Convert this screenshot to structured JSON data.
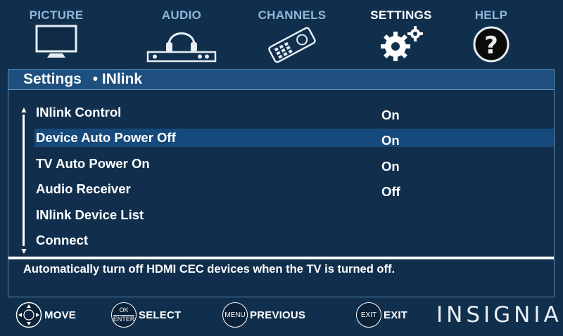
{
  "nav": {
    "tabs": [
      {
        "label": "PICTURE",
        "icon": "tv-icon",
        "active": false
      },
      {
        "label": "AUDIO",
        "icon": "headphones-soundbar-icon",
        "active": false
      },
      {
        "label": "CHANNELS",
        "icon": "remote-control-icon",
        "active": false
      },
      {
        "label": "SETTINGS",
        "icon": "gears-icon",
        "active": true
      },
      {
        "label": "HELP",
        "icon": "question-mark-icon",
        "active": false
      }
    ]
  },
  "header": {
    "section": "Settings",
    "subsection": "INlink",
    "separator": "•"
  },
  "menu": {
    "items": [
      {
        "label": "INlink Control",
        "value": "On",
        "selected": false
      },
      {
        "label": "Device Auto Power Off",
        "value": "On",
        "selected": true
      },
      {
        "label": "TV Auto Power On",
        "value": "On",
        "selected": false
      },
      {
        "label": "Audio Receiver",
        "value": "Off",
        "selected": false
      },
      {
        "label": "INlink Device List",
        "value": "",
        "selected": false
      },
      {
        "label": "Connect",
        "value": "",
        "selected": false
      }
    ]
  },
  "description": "Automatically turn off HDMI CEC devices when the TV is turned off.",
  "footer": {
    "hints": [
      {
        "label": "MOVE",
        "button": "dpad-icon",
        "button_text": ""
      },
      {
        "label": "SELECT",
        "button": "ok-enter-button-icon",
        "button_text": "OK",
        "button_text2": "ENTER"
      },
      {
        "label": "PREVIOUS",
        "button": "menu-button-icon",
        "button_text": "MENU"
      },
      {
        "label": "EXIT",
        "button": "exit-button-icon",
        "button_text": "EXIT"
      }
    ],
    "brand": "INSIGNIA"
  },
  "colors": {
    "background": "#102f4c",
    "header_bar": "#1e4f7e",
    "selection": "#174a7c",
    "tab_inactive": "#8fb8dc",
    "tab_active": "#ffffff"
  }
}
